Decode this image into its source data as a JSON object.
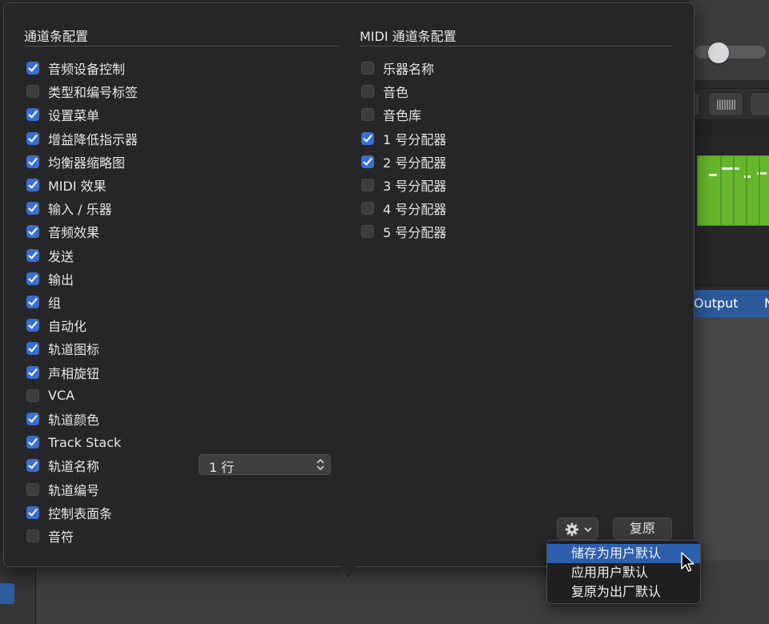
{
  "background": {
    "output_label": "Output",
    "output_label_2": "N"
  },
  "popover": {
    "channel_strip": {
      "title": "通道条配置",
      "items": [
        {
          "label": "音频设备控制",
          "checked": true
        },
        {
          "label": "类型和编号标签",
          "checked": false
        },
        {
          "label": "设置菜单",
          "checked": true
        },
        {
          "label": "增益降低指示器",
          "checked": true
        },
        {
          "label": "均衡器缩略图",
          "checked": true
        },
        {
          "label": "MIDI 效果",
          "checked": true
        },
        {
          "label": "输入 / 乐器",
          "checked": true
        },
        {
          "label": "音频效果",
          "checked": true
        },
        {
          "label": "发送",
          "checked": true
        },
        {
          "label": "输出",
          "checked": true
        },
        {
          "label": "组",
          "checked": true
        },
        {
          "label": "自动化",
          "checked": true
        },
        {
          "label": "轨道图标",
          "checked": true
        },
        {
          "label": "声相旋钮",
          "checked": true
        },
        {
          "label": "VCA",
          "checked": false
        },
        {
          "label": "轨道颜色",
          "checked": true
        },
        {
          "label": "Track Stack",
          "checked": true
        },
        {
          "label": "轨道名称",
          "checked": true
        },
        {
          "label": "轨道编号",
          "checked": false
        },
        {
          "label": "控制表面条",
          "checked": true
        },
        {
          "label": "音符",
          "checked": false
        }
      ],
      "track_name_rows": "1 行"
    },
    "midi_strip": {
      "title": "MIDI 通道条配置",
      "items": [
        {
          "label": "乐器名称",
          "checked": false
        },
        {
          "label": "音色",
          "checked": false
        },
        {
          "label": "音色库",
          "checked": false
        },
        {
          "label": "1 号分配器",
          "checked": true
        },
        {
          "label": "2 号分配器",
          "checked": true
        },
        {
          "label": "3 号分配器",
          "checked": false
        },
        {
          "label": "4 号分配器",
          "checked": false
        },
        {
          "label": "5 号分配器",
          "checked": false
        }
      ]
    },
    "reset_label": "复原",
    "menu": {
      "items": [
        "储存为用户默认",
        "应用用户默认",
        "复原为出厂默认"
      ],
      "highlighted": 0
    }
  },
  "colors": {
    "accent": "#3a6fd0",
    "menu_highlight": "#2e5fae",
    "region_green": "#67b52c"
  }
}
